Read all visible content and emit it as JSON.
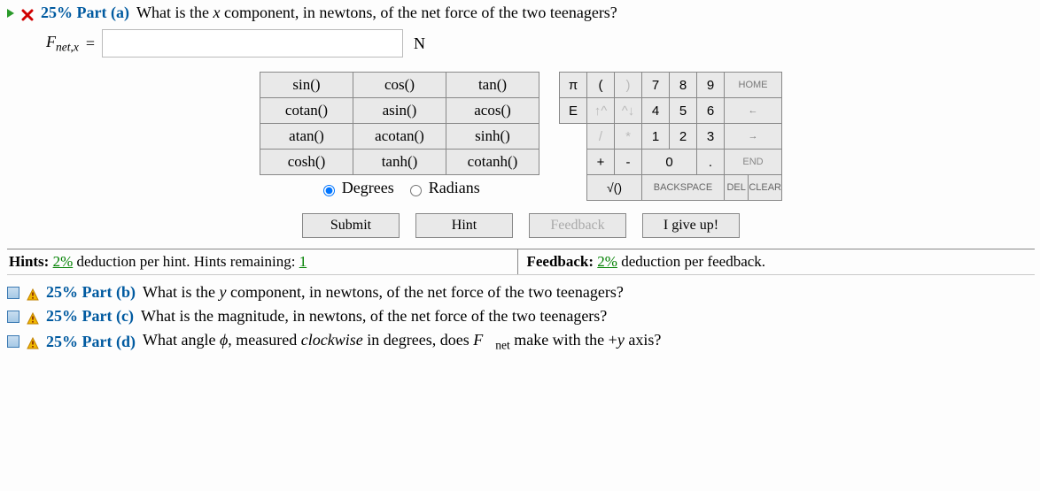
{
  "partA": {
    "pct_label": "25% Part (a)",
    "question_prefix": "What is the ",
    "question_var": "x",
    "question_suffix": " component, in newtons, of the net force of the two teenagers?",
    "answer_label_html": "F",
    "answer_sub": "net,x",
    "eq": "=",
    "value": "",
    "unit": "N"
  },
  "funcs": {
    "r1": [
      "sin()",
      "cos()",
      "tan()"
    ],
    "r2": [
      "cotan()",
      "asin()",
      "acos()"
    ],
    "r3": [
      "atan()",
      "acotan()",
      "sinh()"
    ],
    "r4": [
      "cosh()",
      "tanh()",
      "cotanh()"
    ],
    "mode_deg": "Degrees",
    "mode_rad": "Radians"
  },
  "pad": {
    "pi": "π",
    "lp": "(",
    "rp": ")",
    "n7": "7",
    "n8": "8",
    "n9": "9",
    "home": "HOME",
    "E": "E",
    "up": "↑^",
    "down": "^↓",
    "n4": "4",
    "n5": "5",
    "n6": "6",
    "left": "←",
    "slash": "/",
    "star": "*",
    "n1": "1",
    "n2": "2",
    "n3": "3",
    "right": "→",
    "plus": "+",
    "minus": "-",
    "n0": "0",
    "dot": ".",
    "end": "END",
    "sqrt": "√()",
    "back": "BACKSPACE",
    "del": "DEL",
    "clear": "CLEAR"
  },
  "actions": {
    "submit": "Submit",
    "hint": "Hint",
    "feedback": "Feedback",
    "giveup": "I give up!"
  },
  "hints": {
    "label": "Hints:",
    "deduct_pct": "2%",
    "deduct_text": " deduction per hint. Hints remaining: ",
    "remaining": "1"
  },
  "feedback": {
    "label": "Feedback:",
    "deduct_pct": "2%",
    "deduct_text": " deduction per feedback."
  },
  "partB": {
    "pct": "25% Part (b)",
    "txt_pre": "What is the ",
    "var": "y",
    "txt_post": " component, in newtons, of the net force of the two teenagers?"
  },
  "partC": {
    "pct": "25% Part (c)",
    "txt": "What is the magnitude, in newtons, of the net force of the two teenagers?"
  },
  "partD": {
    "pct": "25% Part (d)",
    "txt_pre": "What angle ",
    "phi": "ϕ",
    "txt_mid": ", measured ",
    "cw": "clockwise",
    "txt_mid2": " in degrees, does ",
    "fnet": "F⃗",
    "fsub": "net",
    "txt_post": " make with the +",
    "yv": "y",
    "txt_end": " axis?"
  }
}
